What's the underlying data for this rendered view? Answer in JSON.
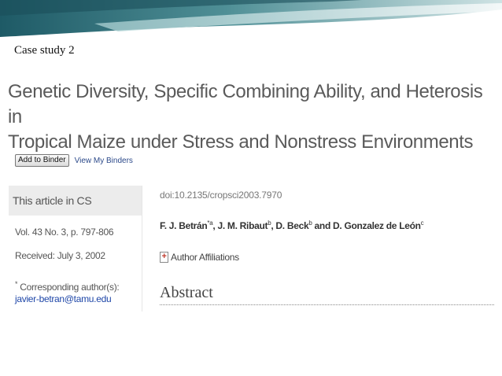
{
  "slide": {
    "case_label": "Case study 2"
  },
  "article": {
    "title_line1": "Genetic Diversity, Specific Combining Ability, and Heterosis in",
    "title_line2": "Tropical Maize under Stress and Nonstress Environments",
    "doi": "doi:10.2135/cropsci2003.7970",
    "authors": {
      "a1": "F. J. Betrán",
      "a1_sup": "*a",
      "a2": ", J. M. Ribaut",
      "a2_sup": "b",
      "a3": ", D. Beck",
      "a3_sup": "b",
      "a4": " and D. Gonzalez de León",
      "a4_sup": "c"
    },
    "affiliations_label": "Author Affiliations",
    "affiliations_toggle": "+",
    "abstract_heading": "Abstract"
  },
  "toolbar": {
    "add_to_binder": "Add to Binder",
    "view_binders": "View My Binders"
  },
  "sidebar": {
    "heading": "This article in CS",
    "volume": "Vol. 43 No. 3, p. 797-806",
    "received": "Received: July 3, 2002",
    "corr_star": "*",
    "corr_label": " Corresponding author(s):",
    "email": "javier-betran@tamu.edu"
  },
  "colors": {
    "banner_teal": "#2a6f7a",
    "link_blue": "#1f47a8",
    "title_gray": "#5a5a5a"
  }
}
